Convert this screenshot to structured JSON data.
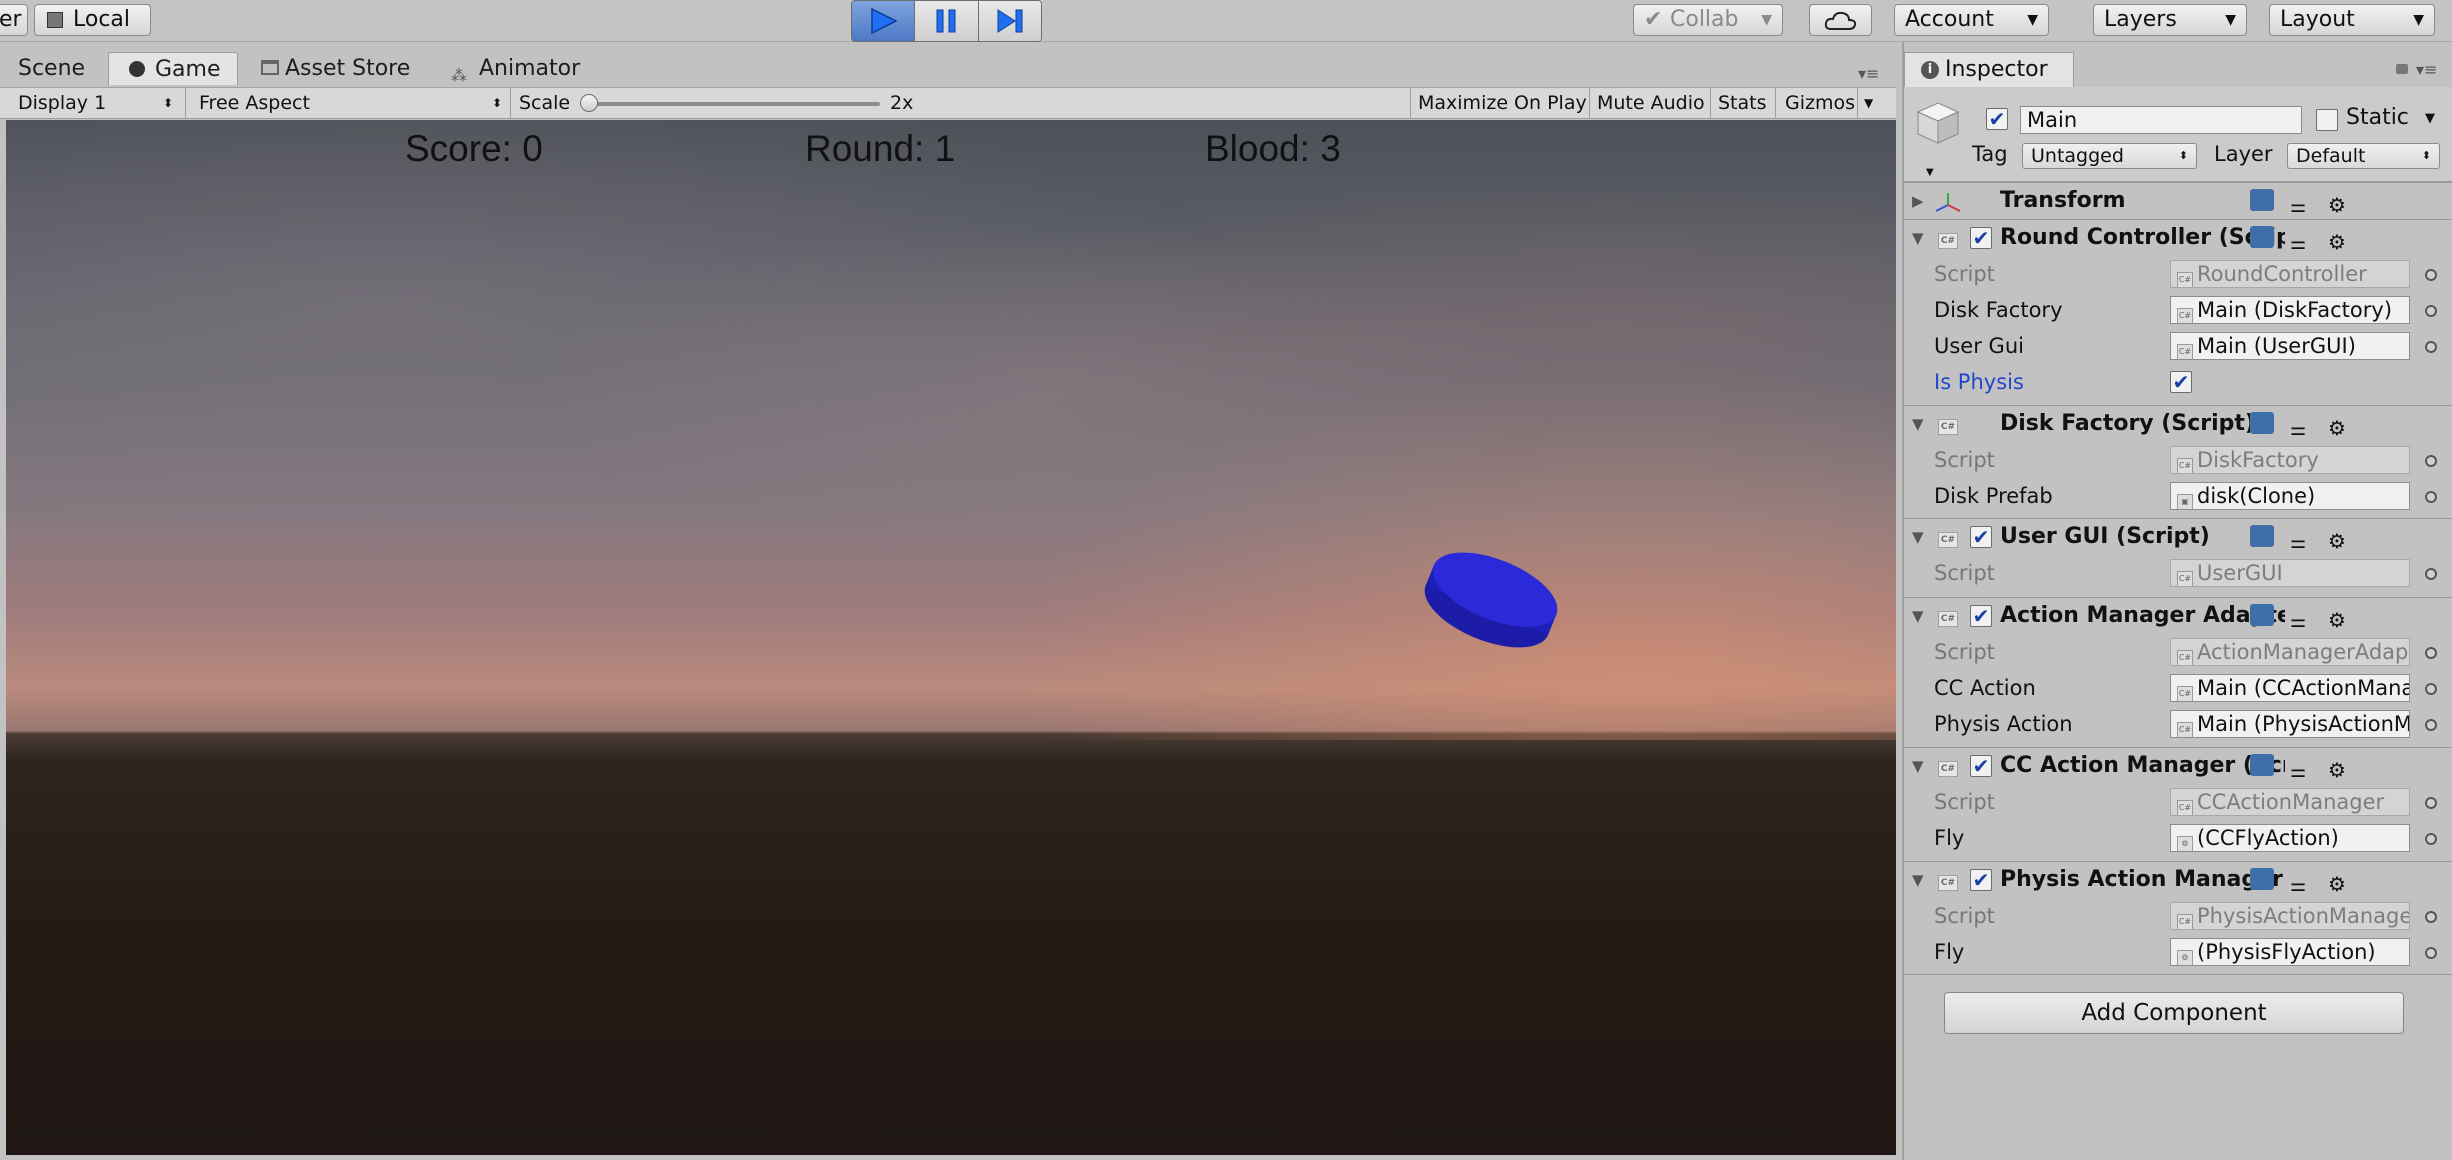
{
  "toolbar": {
    "pivot_label": "er",
    "local_label": "Local",
    "collab_label": "Collab",
    "account_label": "Account",
    "layers_label": "Layers",
    "layout_label": "Layout"
  },
  "tabs": {
    "scene": "Scene",
    "game": "Game",
    "asset_store": "Asset Store",
    "animator": "Animator"
  },
  "game_toolbar": {
    "display": "Display 1",
    "aspect": "Free Aspect",
    "scale_label": "Scale",
    "scale_value": "2x",
    "maximize_on_play": "Maximize On Play",
    "mute_audio": "Mute Audio",
    "stats": "Stats",
    "gizmos": "Gizmos"
  },
  "hud": {
    "score": "Score: 0",
    "round": "Round: 1",
    "blood": "Blood: 3"
  },
  "inspector": {
    "tab_label": "Inspector",
    "object_name": "Main",
    "static_label": "Static",
    "tag_label": "Tag",
    "tag_value": "Untagged",
    "layer_label": "Layer",
    "layer_value": "Default",
    "transform": {
      "title": "Transform"
    },
    "round_controller": {
      "title": "Round Controller (Script)",
      "script_label": "Script",
      "script_value": "RoundController",
      "disk_factory_label": "Disk Factory",
      "disk_factory_value": "Main (DiskFactory)",
      "user_gui_label": "User Gui",
      "user_gui_value": "Main (UserGUI)",
      "is_physis_label": "Is Physis"
    },
    "disk_factory": {
      "title": "Disk Factory (Script)",
      "script_label": "Script",
      "script_value": "DiskFactory",
      "disk_prefab_label": "Disk Prefab",
      "disk_prefab_value": "disk(Clone)"
    },
    "user_gui": {
      "title": "User GUI (Script)",
      "script_label": "Script",
      "script_value": "UserGUI"
    },
    "action_manager_adapter": {
      "title": "Action Manager Adapter",
      "script_label": "Script",
      "script_value": "ActionManagerAdapter",
      "cc_action_label": "CC Action",
      "cc_action_value": "Main (CCActionManager)",
      "physis_action_label": "Physis Action",
      "physis_action_value": "Main (PhysisActionManager)"
    },
    "cc_action_manager": {
      "title": "CC Action Manager (Script)",
      "script_label": "Script",
      "script_value": "CCActionManager",
      "fly_label": "Fly",
      "fly_value": "(CCFlyAction)"
    },
    "physis_action_manager": {
      "title": "Physis Action Manager (Script)",
      "script_label": "Script",
      "script_value": "PhysisActionManager",
      "fly_label": "Fly",
      "fly_value": "(PhysisFlyAction)"
    },
    "add_component": "Add Component"
  },
  "colors": {
    "accent_blue": "#2347c8",
    "disk_blue": "#2a2ad8"
  }
}
